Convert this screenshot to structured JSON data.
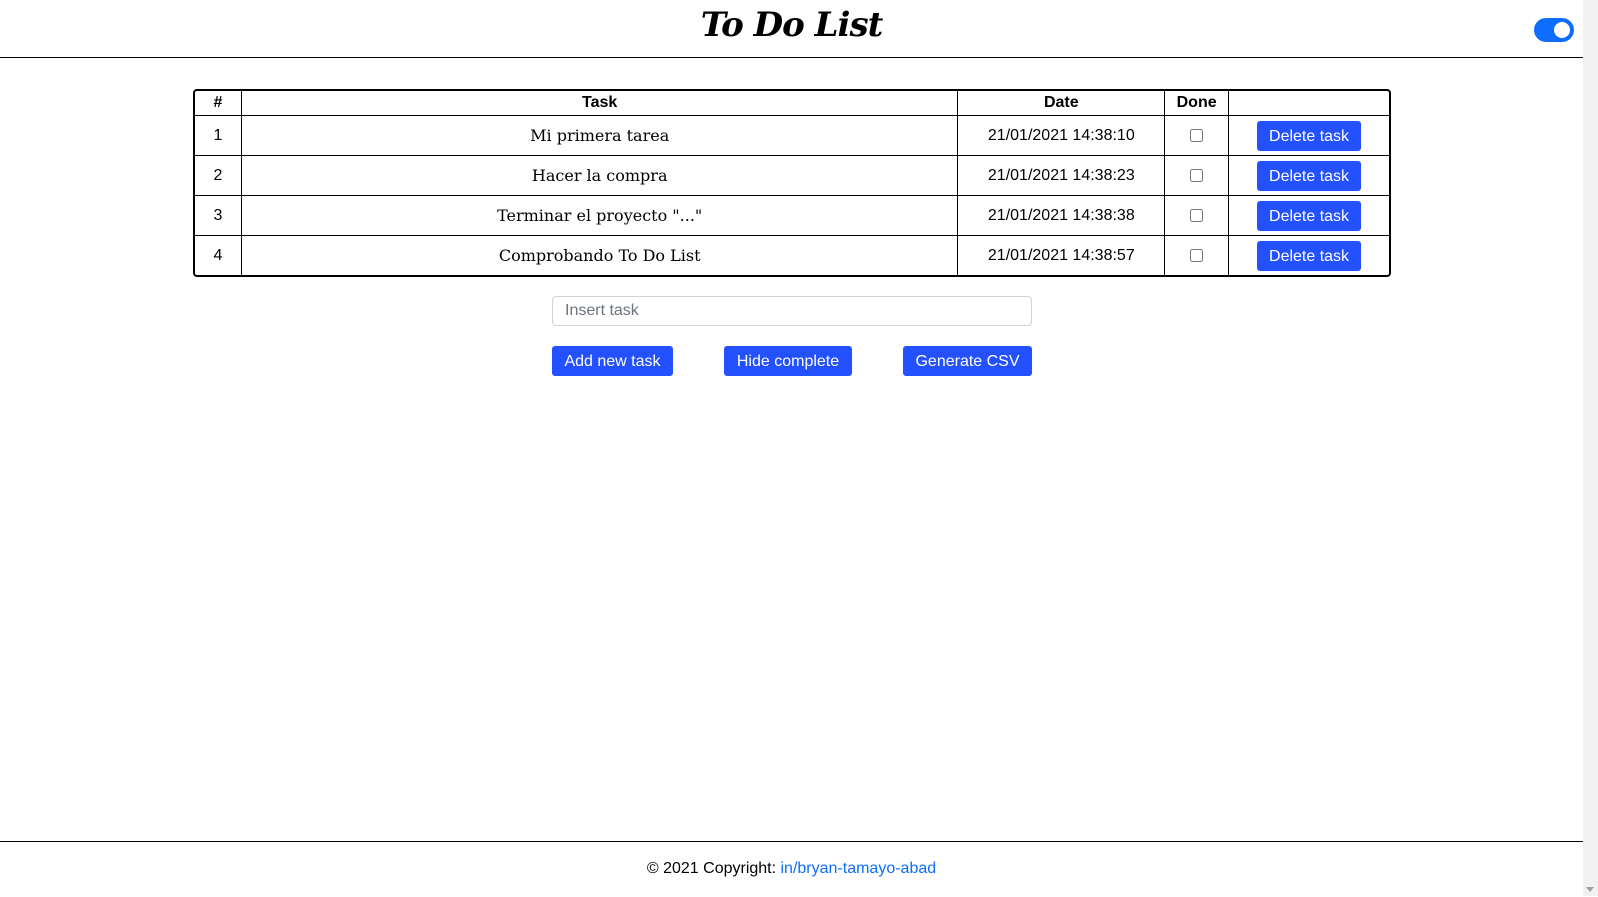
{
  "header": {
    "title": "To Do List"
  },
  "table": {
    "columns": [
      "#",
      "Task",
      "Date",
      "Done",
      ""
    ],
    "rows": [
      {
        "num": "1",
        "task": "Mi primera tarea",
        "date": "21/01/2021 14:38:10",
        "done": false,
        "action": "Delete task"
      },
      {
        "num": "2",
        "task": "Hacer la compra",
        "date": "21/01/2021 14:38:23",
        "done": false,
        "action": "Delete task"
      },
      {
        "num": "3",
        "task": "Terminar el proyecto \"...\"",
        "date": "21/01/2021 14:38:38",
        "done": false,
        "action": "Delete task"
      },
      {
        "num": "4",
        "task": "Comprobando To Do List",
        "date": "21/01/2021 14:38:57",
        "done": false,
        "action": "Delete task"
      }
    ]
  },
  "controls": {
    "input_placeholder": "Insert task",
    "add_label": "Add new task",
    "hide_label": "Hide complete",
    "csv_label": "Generate CSV"
  },
  "footer": {
    "text": "© 2021 Copyright: ",
    "link": "in/bryan-tamayo-abad"
  },
  "colors": {
    "accent": "#2451ff",
    "link": "#0d6efd",
    "toggle": "#0d6efd"
  },
  "icons": [
    "toggle-switch-icon",
    "scroll-down-arrow-icon"
  ]
}
